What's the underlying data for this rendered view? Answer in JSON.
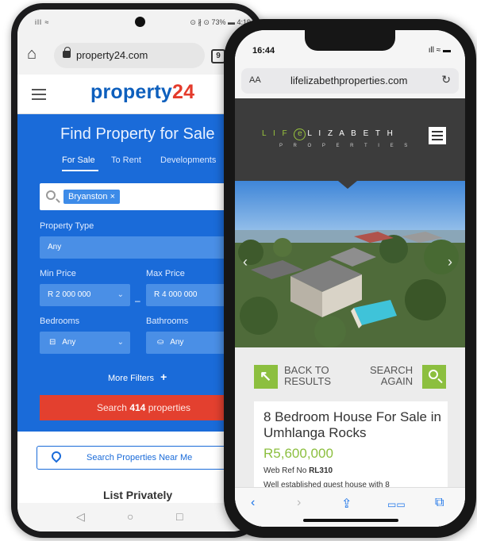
{
  "android": {
    "status": {
      "signal": "ill ≈",
      "right": "⊙ ∦ ⊙ 73% ▬ 4:19"
    },
    "browser": {
      "url": "property24.com",
      "tab_count": "9"
    },
    "header": {
      "logo_word": "property",
      "logo_num": "24"
    },
    "search": {
      "title": "Find Property for Sale",
      "tabs": [
        "For Sale",
        "To Rent",
        "Developments"
      ],
      "location_chip": "Bryanston ×",
      "property_type_label": "Property Type",
      "property_type_value": "Any",
      "min_price_label": "Min Price",
      "max_price_label": "Max Price",
      "min_price_value": "R 2 000 000",
      "max_price_value": "R 4 000 000",
      "bedrooms_label": "Bedrooms",
      "bathrooms_label": "Bathrooms",
      "bedrooms_value": "Any",
      "bathrooms_value": "Any",
      "more_filters": "More Filters",
      "search_prefix": "Search",
      "search_count": "414",
      "search_suffix": "properties"
    },
    "near_me": "Search Properties Near Me",
    "list_privately": "List Privately"
  },
  "iphone": {
    "time": "16:44",
    "status_icons": "ıll ≈ ▬",
    "browser": {
      "aa": "AA",
      "url": "lifelizabethproperties.com",
      "reload": "↻"
    },
    "header": {
      "logo_life": "L I F",
      "logo_at": "e",
      "logo_elizabeth": "L I Z A B E T H",
      "logo_sub": "P R O P E R T I E S"
    },
    "nav": {
      "back_line1": "BACK TO",
      "back_line2": "RESULTS",
      "search_line1": "SEARCH",
      "search_line2": "AGAIN"
    },
    "listing": {
      "title": "8 Bedroom House For Sale in Umhlanga Rocks",
      "price": "R5,600,000",
      "ref_label": "Web Ref No",
      "ref_value": "RL310",
      "description": "Well established guest house with 8"
    },
    "toolbar": [
      "‹",
      "›",
      "⇪",
      "▭▭",
      "⧉"
    ]
  },
  "colors": {
    "p24_blue": "#1a6bd9",
    "p24_red": "#e3402f",
    "life_green": "#8cbf3f",
    "life_header": "#3c3c3c"
  }
}
